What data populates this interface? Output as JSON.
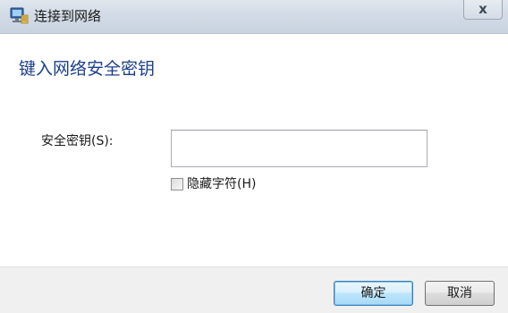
{
  "window": {
    "title": "连接到网络",
    "close_label": "x"
  },
  "main": {
    "heading": "键入网络安全密钥",
    "key_label": "安全密钥(S):",
    "key_value": "",
    "hide_chars_label": "隐藏字符(H)",
    "hide_chars_checked": false
  },
  "footer": {
    "ok_label": "确定",
    "cancel_label": "取消"
  },
  "colors": {
    "heading": "#1b3f8c",
    "titlebar": "#d2dbe6",
    "footer": "#f0f0f0"
  },
  "icons": {
    "title_icon": "network-icon",
    "close_icon": "close-icon"
  }
}
